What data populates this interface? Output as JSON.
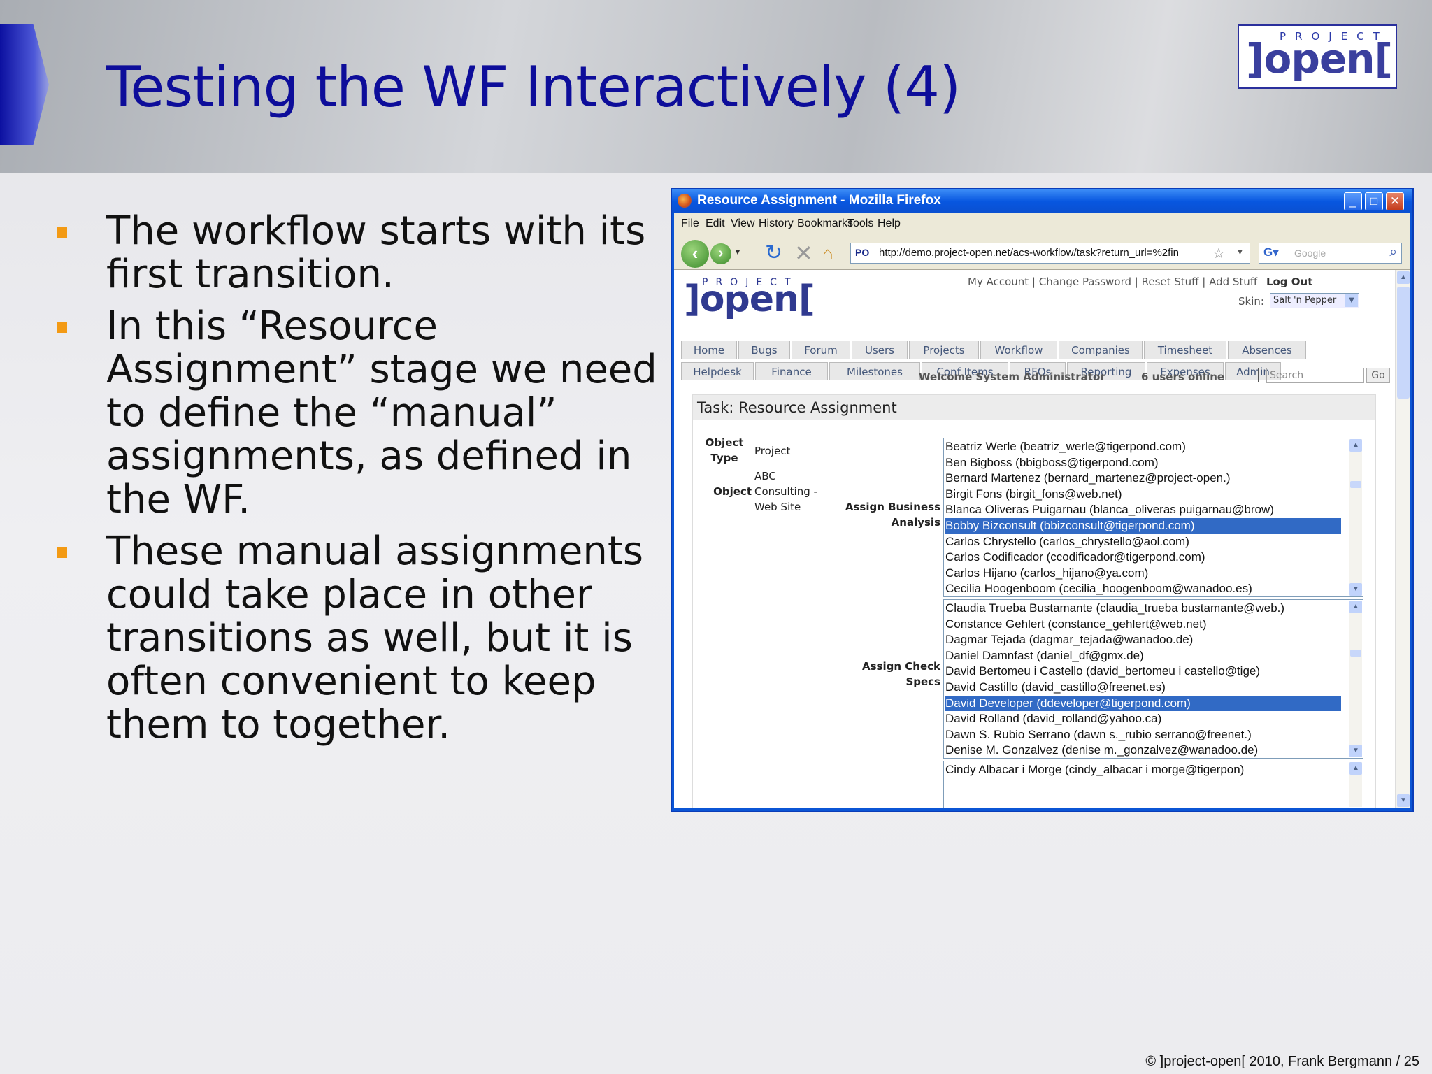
{
  "slide": {
    "title": "Testing the WF Interactively (4)",
    "logo": {
      "small": "PROJECT",
      "big": "]open["
    },
    "bullets": [
      "The workflow starts with its first transition.",
      "In this “Resource Assignment” stage we need to define the “manual” assignments, as defined in the WF.",
      "These manual assignments could take place in other transitions as well, but it is often convenient to keep them to together."
    ],
    "footer": "©  ]project-open[  2010, Frank Bergmann / 25"
  },
  "browser": {
    "window_title": "Resource Assignment - Mozilla Firefox",
    "menu": [
      "File",
      "Edit",
      "View",
      "History",
      "Bookmarks",
      "Tools",
      "Help"
    ],
    "url": "http://demo.project-open.net/acs-workflow/task?return_url=%2fin",
    "search_placeholder": "Google",
    "favicon": "PO"
  },
  "page": {
    "logo_small": "PROJECT",
    "logo_big": "]open[",
    "top_links": "My Account | Change Password | Reset Stuff | Add Stuff",
    "logout": "Log Out",
    "skin_label": "Skin:",
    "skin_value": "Salt 'n Pepper",
    "tabs_row1": [
      "Home",
      "Bugs",
      "Forum",
      "Users",
      "Projects",
      "Workflow",
      "Companies",
      "Timesheet",
      "Absences"
    ],
    "tabs_row2": [
      "Helpdesk",
      "Finance",
      "Milestones",
      "Conf Items",
      "RFQs",
      "Reporting",
      "Expenses",
      "Admin"
    ],
    "welcome": "Welcome System Administrator",
    "online": "6 users online",
    "search_placeholder": "Search",
    "go": "Go",
    "task": {
      "heading": "Task: Resource Assignment",
      "object_type_label": "Object Type",
      "object_type_value": "Project",
      "object_label": "Object",
      "object_value": "ABC Consulting - Web Site",
      "assign_business_label": "Assign Business Analysis",
      "assign_check_label": "Assign Check Specs",
      "list1": [
        "Beatriz Werle (beatriz_werle@tigerpond.com)",
        "Ben Bigboss (bbigboss@tigerpond.com)",
        "Bernard Martenez (bernard_martenez@project-open.)",
        "Birgit Fons (birgit_fons@web.net)",
        "Blanca Oliveras Puigarnau (blanca_oliveras puigarnau@brow)",
        "Bobby Bizconsult (bbizconsult@tigerpond.com)",
        "Carlos Chrystello (carlos_chrystello@aol.com)",
        "Carlos Codificador (ccodificador@tigerpond.com)",
        "Carlos Hijano (carlos_hijano@ya.com)",
        "Cecilia Hoogenboom (cecilia_hoogenboom@wanadoo.es)"
      ],
      "list1_selected": 5,
      "list2": [
        "Claudia Trueba Bustamante (claudia_trueba bustamante@web.)",
        "Constance Gehlert (constance_gehlert@web.net)",
        "Dagmar Tejada (dagmar_tejada@wanadoo.de)",
        "Daniel Damnfast (daniel_df@gmx.de)",
        "David Bertomeu i Castello (david_bertomeu i castello@tige)",
        "David Castillo (david_castillo@freenet.es)",
        "David Developer (ddeveloper@tigerpond.com)",
        "David Rolland (david_rolland@yahoo.ca)",
        "Dawn S. Rubio Serrano (dawn s._rubio serrano@freenet.)",
        "Denise M. Gonzalvez (denise m._gonzalvez@wanadoo.de)"
      ],
      "list2_selected": 6,
      "list3": [
        "Cindy Albacar i Morge (cindy_albacar i morge@tigerpon)"
      ]
    }
  },
  "colors": {
    "title": "#0d0d9a",
    "bullet": "#f39a14",
    "selection": "#316ac5"
  }
}
